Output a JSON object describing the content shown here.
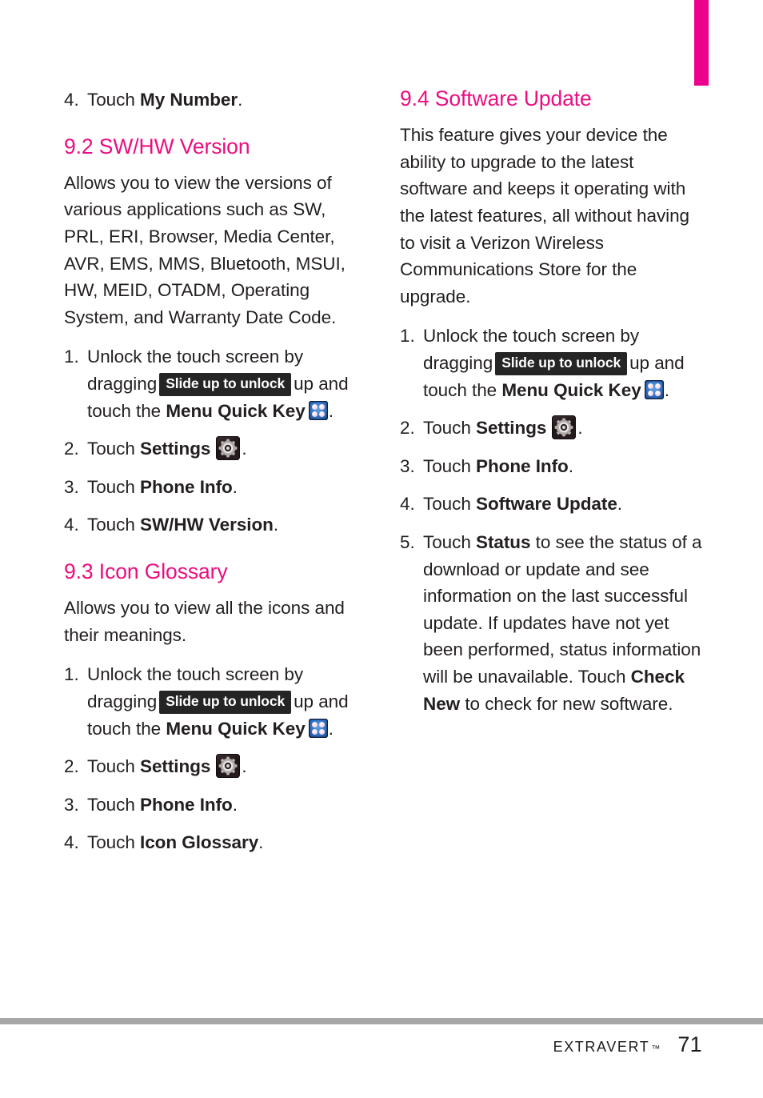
{
  "colors": {
    "heading_pink": "#ec0d80",
    "tab_marker_pink": "#ec008c",
    "body_text": "#231f20",
    "badge_background": "#252525",
    "badge_text": "#ffffff",
    "footer_rule": "#a7a7a7"
  },
  "icons": {
    "menu_quick_key": "menu-quick-key-icon",
    "settings_gear": "settings-gear-icon"
  },
  "badges": {
    "slide_up_to_unlock": "Slide up to unlock"
  },
  "left_column": {
    "lead_item": {
      "number": "4.",
      "text_before": "Touch ",
      "bold": "My Number",
      "text_after": "."
    },
    "section_92": {
      "heading": "9.2 SW/HW Version",
      "paragraph": "Allows you to view the versions of various applications such as SW, PRL, ERI, Browser, Media Center, AVR, EMS, MMS, Bluetooth, MSUI, HW, MEID, OTADM, Operating System, and Warranty Date Code.",
      "steps": [
        {
          "number": "1.",
          "seg1": "Unlock the touch screen by dragging",
          "badge": "Slide up to unlock",
          "seg2": "up and touch the ",
          "bold": "Menu Quick Key",
          "seg3": "."
        },
        {
          "number": "2.",
          "text_before": "Touch ",
          "bold": "Settings",
          "text_after": "."
        },
        {
          "number": "3.",
          "text_before": "Touch ",
          "bold": "Phone Info",
          "text_after": "."
        },
        {
          "number": "4.",
          "text_before": "Touch ",
          "bold": "SW/HW Version",
          "text_after": "."
        }
      ]
    },
    "section_93": {
      "heading": "9.3 Icon Glossary",
      "paragraph": "Allows you to view all the icons and their meanings.",
      "steps": [
        {
          "number": "1.",
          "seg1": "Unlock the touch screen by dragging",
          "badge": "Slide up to unlock",
          "seg2": "up and touch the ",
          "bold": "Menu Quick Key",
          "seg3": "."
        },
        {
          "number": "2.",
          "text_before": "Touch ",
          "bold": "Settings",
          "text_after": "."
        },
        {
          "number": "3.",
          "text_before": "Touch ",
          "bold": "Phone Info",
          "text_after": "."
        },
        {
          "number": "4.",
          "text_before": "Touch ",
          "bold": "Icon Glossary",
          "text_after": "."
        }
      ]
    }
  },
  "right_column": {
    "section_94": {
      "heading": "9.4 Software Update",
      "paragraph": "This feature gives your device the ability to upgrade to the latest software and keeps it operating with the latest features, all without having to visit a Verizon Wireless Communications Store for the upgrade.",
      "steps": [
        {
          "number": "1.",
          "seg1": "Unlock the touch screen by dragging",
          "badge": "Slide up to unlock",
          "seg2": "up and touch the ",
          "bold": "Menu Quick Key",
          "seg3": "."
        },
        {
          "number": "2.",
          "text_before": "Touch ",
          "bold": "Settings",
          "text_after": "."
        },
        {
          "number": "3.",
          "text_before": "Touch ",
          "bold": "Phone Info",
          "text_after": "."
        },
        {
          "number": "4.",
          "text_before": "Touch ",
          "bold": "Software Update",
          "text_after": "."
        },
        {
          "number": "5.",
          "seg1": "Touch ",
          "bold1": "Status",
          "seg2": " to see the status of a download or update and see information on the last successful update. If updates have not yet been performed, status information will be unavailable. Touch ",
          "bold2": "Check New",
          "seg3": " to check for new software."
        }
      ]
    }
  },
  "footer": {
    "brand": "Extravert",
    "trademark": "™",
    "page_number": "71"
  }
}
